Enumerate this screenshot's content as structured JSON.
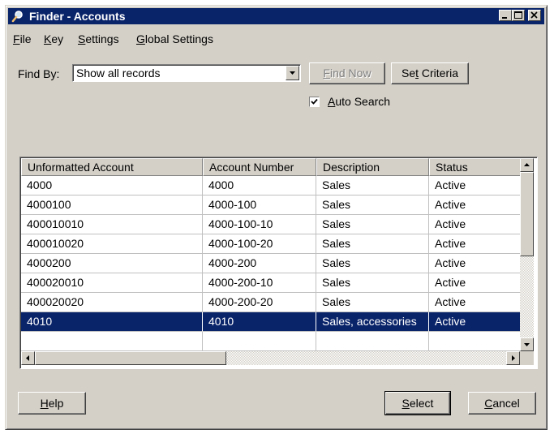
{
  "window": {
    "title": "Finder - Accounts"
  },
  "menu": [
    {
      "label": "File",
      "mnemonic": "F",
      "rest": "ile"
    },
    {
      "label": "Key",
      "mnemonic": "K",
      "rest": "ey"
    },
    {
      "label": "Settings",
      "mnemonic": "S",
      "rest": "ettings"
    },
    {
      "label": "Global Settings",
      "mnemonic": "G",
      "rest": "lobal Settings"
    }
  ],
  "find": {
    "label": "Find By:",
    "selected": "Show all records",
    "find_now": {
      "label": "Find Now",
      "mnemonic": "F",
      "rest": "ind Now",
      "enabled": false
    },
    "set_criteria": {
      "label": "Set Criteria",
      "pre": "Se",
      "mnemonic": "t",
      "rest": " Criteria"
    },
    "auto_search": {
      "label": "Auto Search",
      "mnemonic": "A",
      "rest": "uto Search",
      "checked": true
    }
  },
  "table": {
    "columns": [
      "Unformatted Account",
      "Account Number",
      "Description",
      "Status"
    ],
    "rows": [
      [
        "4000",
        "4000",
        "Sales",
        "Active"
      ],
      [
        "4000100",
        "4000-100",
        "Sales",
        "Active"
      ],
      [
        "400010010",
        "4000-100-10",
        "Sales",
        "Active"
      ],
      [
        "400010020",
        "4000-100-20",
        "Sales",
        "Active"
      ],
      [
        "4000200",
        "4000-200",
        "Sales",
        "Active"
      ],
      [
        "400020010",
        "4000-200-10",
        "Sales",
        "Active"
      ],
      [
        "400020020",
        "4000-200-20",
        "Sales",
        "Active"
      ],
      [
        "4010",
        "4010",
        "Sales, accessories",
        "Active"
      ]
    ],
    "selected_row": 7
  },
  "buttons": {
    "help": {
      "label": "Help",
      "mnemonic": "H",
      "rest": "elp"
    },
    "select": {
      "label": "Select",
      "mnemonic": "S",
      "rest": "elect"
    },
    "cancel": {
      "label": "Cancel",
      "mnemonic": "C",
      "rest": "ancel"
    }
  },
  "colors": {
    "titlebar": "#0a246a",
    "face": "#d4d0c8",
    "selection": "#0a246a"
  }
}
